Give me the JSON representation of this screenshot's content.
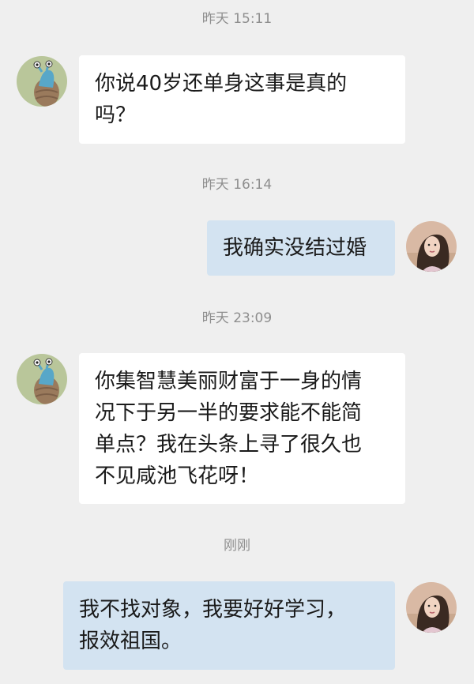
{
  "chat": {
    "messages": [
      {
        "time": "昨天 15:11",
        "side": "left",
        "text": "你说40岁还单身这事是真的吗？"
      },
      {
        "time": "昨天 16:14",
        "side": "right",
        "text": "我确实没结过婚"
      },
      {
        "time": "昨天 23:09",
        "side": "left",
        "text": "你集智慧美丽财富于一身的情况下于另一半的要求能不能简单点？我在头条上寻了很久也不见咸池飞花呀！"
      },
      {
        "time": "刚刚",
        "side": "right",
        "text": "我不找对象，我要好好学习，报效祖国。"
      }
    ]
  },
  "colors": {
    "background": "#efefef",
    "left_bubble": "#ffffff",
    "right_bubble": "#d3e3f1",
    "timestamp": "#8e8e8e"
  },
  "icons": {
    "other_avatar": "snail-cartoon-avatar",
    "self_avatar": "woman-photo-avatar"
  }
}
